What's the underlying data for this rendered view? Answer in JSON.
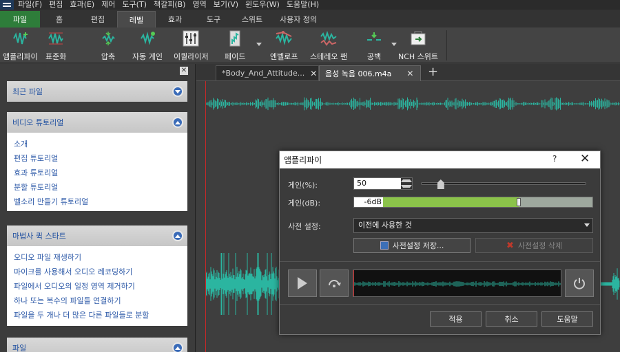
{
  "menu": [
    "파일(F)",
    "편집",
    "효과(E)",
    "제어",
    "도구(T)",
    "책갈피(B)",
    "영역",
    "보기(V)",
    "윈도우(W)",
    "도움말(H)"
  ],
  "ribbon_tabs": [
    "파일",
    "홈",
    "편집",
    "레벨",
    "효과",
    "도구",
    "스위트",
    "사용자 정의"
  ],
  "toolbar": {
    "amplify": "앰플리파이",
    "normalize": "표준화",
    "compress": "압축",
    "auto_gain": "자동 게인",
    "equalizer": "이퀄라이저",
    "fade": "페이드",
    "envelope": "엔벨로프",
    "stereo_pan": "스테레오 팬",
    "silence": "공백",
    "nch_suite": "NCH 스위트"
  },
  "sidebar": {
    "close_glyph": "✕",
    "recent": {
      "title": "최근 파일"
    },
    "video": {
      "title": "비디오 튜토리얼",
      "items": [
        "소개",
        "편집 튜토리얼",
        "효과 튜토리얼",
        "분할 튜토리얼",
        "벨소리 만들기 튜토리얼"
      ]
    },
    "wizard": {
      "title": "마법사 퀵 스타트",
      "items": [
        "오디오 파일 재생하기",
        "마이크를 사용해서 오디오 레코딩하기",
        "파일에서 오디오의 일정 영역 제거하기",
        "하나 또는 복수의 파일들 연결하기",
        "파일을 두 개나 더 많은 다른 파일들로 분할"
      ]
    },
    "file": {
      "title": "파일"
    }
  },
  "doc_tabs": [
    "*Body_And_Attitude...",
    "음성 녹음 006.m4a"
  ],
  "tab_close_glyph": "✕",
  "add_tab_glyph": "+",
  "dialog": {
    "title": "앰플리파이",
    "help_glyph": "?",
    "close_glyph": "✕",
    "gain_pct_label": "게인(%):",
    "gain_pct_value": "50",
    "gain_slider_fraction": 0.12,
    "gain_db_label": "게인(dB):",
    "gain_db_value": "-6dB",
    "gain_db_fill_fraction": 0.69,
    "preset_label": "사전 설정:",
    "preset_value": "이전에 사용한 것",
    "save_preset": "사전설정 저장...",
    "delete_preset": "사전설정 삭제",
    "apply": "적용",
    "cancel": "취소",
    "help": "도움말"
  },
  "colors": {
    "waveform": "#2bb5a0",
    "playhead": "#c62828",
    "file_tab": "#2e7d3a",
    "db_fill": "#8bc34a",
    "link": "#2e5aa8"
  }
}
